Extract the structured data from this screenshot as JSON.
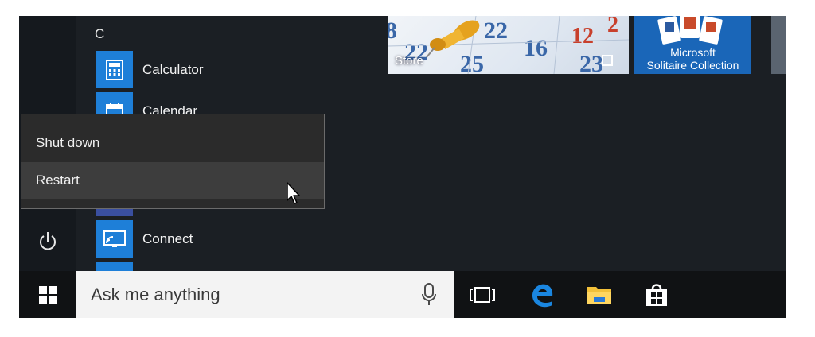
{
  "start_menu": {
    "section_letter": "C",
    "apps": [
      {
        "label": "Calculator",
        "icon": "calculator-icon"
      },
      {
        "label": "Calendar",
        "icon": "calendar-icon"
      },
      {
        "label": "Connect",
        "icon": "connect-icon"
      }
    ],
    "tiles": [
      {
        "label": "Store",
        "icon": "store-tile"
      },
      {
        "label_line1": "Microsoft",
        "label_line2": "Solitaire Collection",
        "icon": "solitaire-tile"
      }
    ]
  },
  "power_menu": {
    "items": [
      {
        "label": "Shut down",
        "highlighted": false
      },
      {
        "label": "Restart",
        "highlighted": true
      }
    ]
  },
  "taskbar": {
    "search_placeholder": "Ask me anything",
    "icons": [
      "windows-start-icon",
      "microphone-icon",
      "task-view-icon",
      "edge-icon",
      "file-explorer-icon",
      "store-icon"
    ]
  },
  "colors": {
    "accent": "#1e7fd8",
    "menu_bg": "#2b2b2b",
    "taskbar_bg": "#101214",
    "search_bg": "#f3f3f3"
  }
}
